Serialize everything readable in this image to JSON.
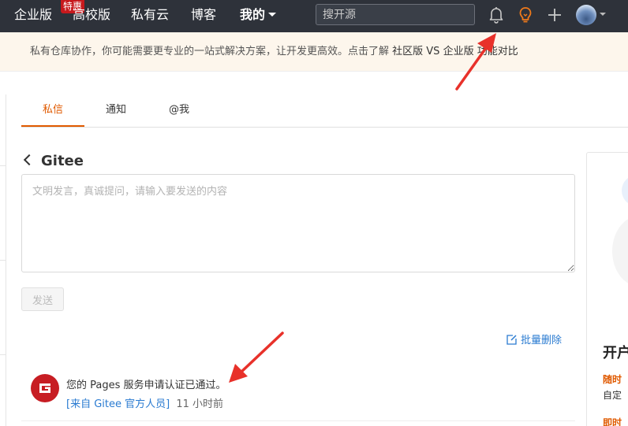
{
  "nav": {
    "enterprise": "企业版",
    "enterprise_badge": "特惠",
    "education": "高校版",
    "private_cloud": "私有云",
    "blog": "博客",
    "mine": "我的",
    "search_placeholder": "搜开源"
  },
  "banner": {
    "text": "私有仓库协作，你可能需要更专业的一站式解决方案，让开发更高效。点击了解",
    "link_text": "社区版 VS 企业版 功能对比"
  },
  "tabs": [
    {
      "label": "私信",
      "active": true
    },
    {
      "label": "通知",
      "active": false
    },
    {
      "label": "@我",
      "active": false
    }
  ],
  "conversation": {
    "title": "Gitee",
    "input_placeholder": "文明发言，真诚提问，请输入要发送的内容",
    "send_label": "发送",
    "bulk_delete_label": "批量删除"
  },
  "messages": [
    {
      "text": "您的 Pages 服务申请认证已通过。",
      "source": "[来自 Gitee 官方人员]",
      "time": "11 小时前"
    }
  ],
  "right_panel": {
    "heading": "开户",
    "line1": "随时",
    "line2": "自定",
    "line3": "即时"
  },
  "colors": {
    "nav_bg": "#2e323a",
    "accent_orange": "#e05a00",
    "link_blue": "#2a7bd1",
    "badge_red": "#c7191d",
    "gitee_red": "#c71d23",
    "annotation_red": "#e8312a"
  }
}
